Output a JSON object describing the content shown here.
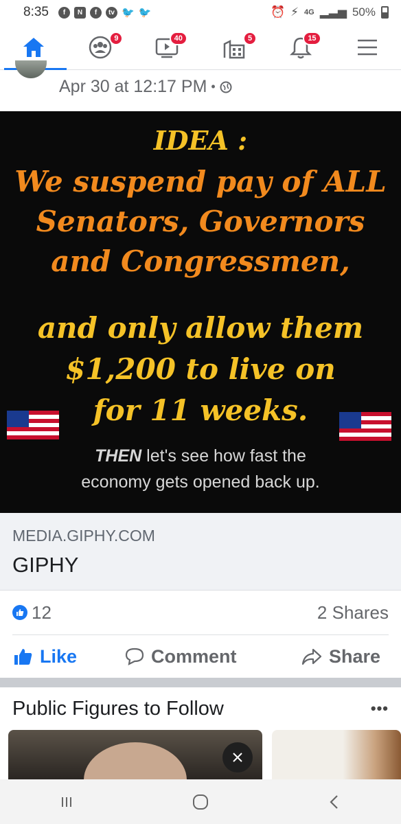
{
  "status_bar": {
    "time": "8:35",
    "network": "4G",
    "battery": "50%"
  },
  "nav": {
    "badges": {
      "friends": "9",
      "watch": "40",
      "marketplace": "5",
      "notifications": "15"
    },
    "active": "home",
    "accent_color": "#1877f2",
    "badge_color": "#e41e3f"
  },
  "post": {
    "timestamp": "Apr 30 at 12:17 PM",
    "privacy_icon": "globe-icon",
    "image_text": {
      "idea": "IDEA :",
      "line1": "We suspend pay of ALL",
      "line2": "Senators, Governors",
      "line3": "and Congressmen,",
      "line4": "and  only allow them",
      "line5": "$1,200 to live on",
      "line6": "for 11 weeks.",
      "then_word": "THEN",
      "then_rest": " let's see how fast the",
      "last_line": "economy gets opened back up."
    },
    "link": {
      "domain": "MEDIA.GIPHY.COM",
      "title": "GIPHY"
    },
    "reactions": {
      "count": "12",
      "shares": "2 Shares"
    },
    "actions": {
      "like": "Like",
      "comment": "Comment",
      "share": "Share"
    }
  },
  "public_figures": {
    "title": "Public Figures to Follow",
    "more": "•••"
  }
}
